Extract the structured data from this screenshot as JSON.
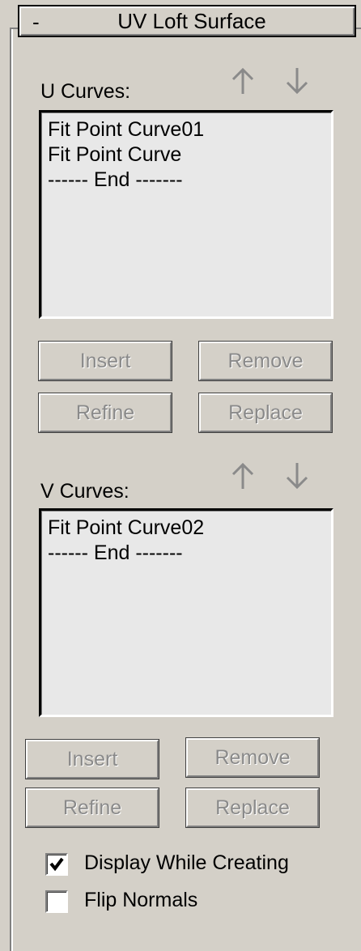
{
  "rollout": {
    "collapse_symbol": "-",
    "title": "UV Loft Surface"
  },
  "u_curves": {
    "label": "U Curves:",
    "move_up_icon": "arrow-up-icon",
    "move_down_icon": "arrow-down-icon",
    "items": [
      "Fit Point Curve01",
      "Fit Point Curve",
      "------ End -------"
    ]
  },
  "u_buttons": {
    "insert": "Insert",
    "remove": "Remove",
    "refine": "Refine",
    "replace": "Replace"
  },
  "v_curves": {
    "label": "V Curves:",
    "move_up_icon": "arrow-up-icon",
    "move_down_icon": "arrow-down-icon",
    "items": [
      "Fit Point Curve02",
      "------ End -------"
    ]
  },
  "v_buttons": {
    "insert": "Insert",
    "remove": "Remove",
    "refine": "Refine",
    "replace": "Replace"
  },
  "options": {
    "display_while_creating": {
      "label": "Display While Creating",
      "checked": true
    },
    "flip_normals": {
      "label": "Flip Normals",
      "checked": false
    }
  },
  "colors": {
    "panel_bg": "#d4d0c8",
    "list_bg": "#e8e8e8",
    "disabled_text": "#8a8a8a",
    "arrow_gray": "#8a8a8a"
  }
}
